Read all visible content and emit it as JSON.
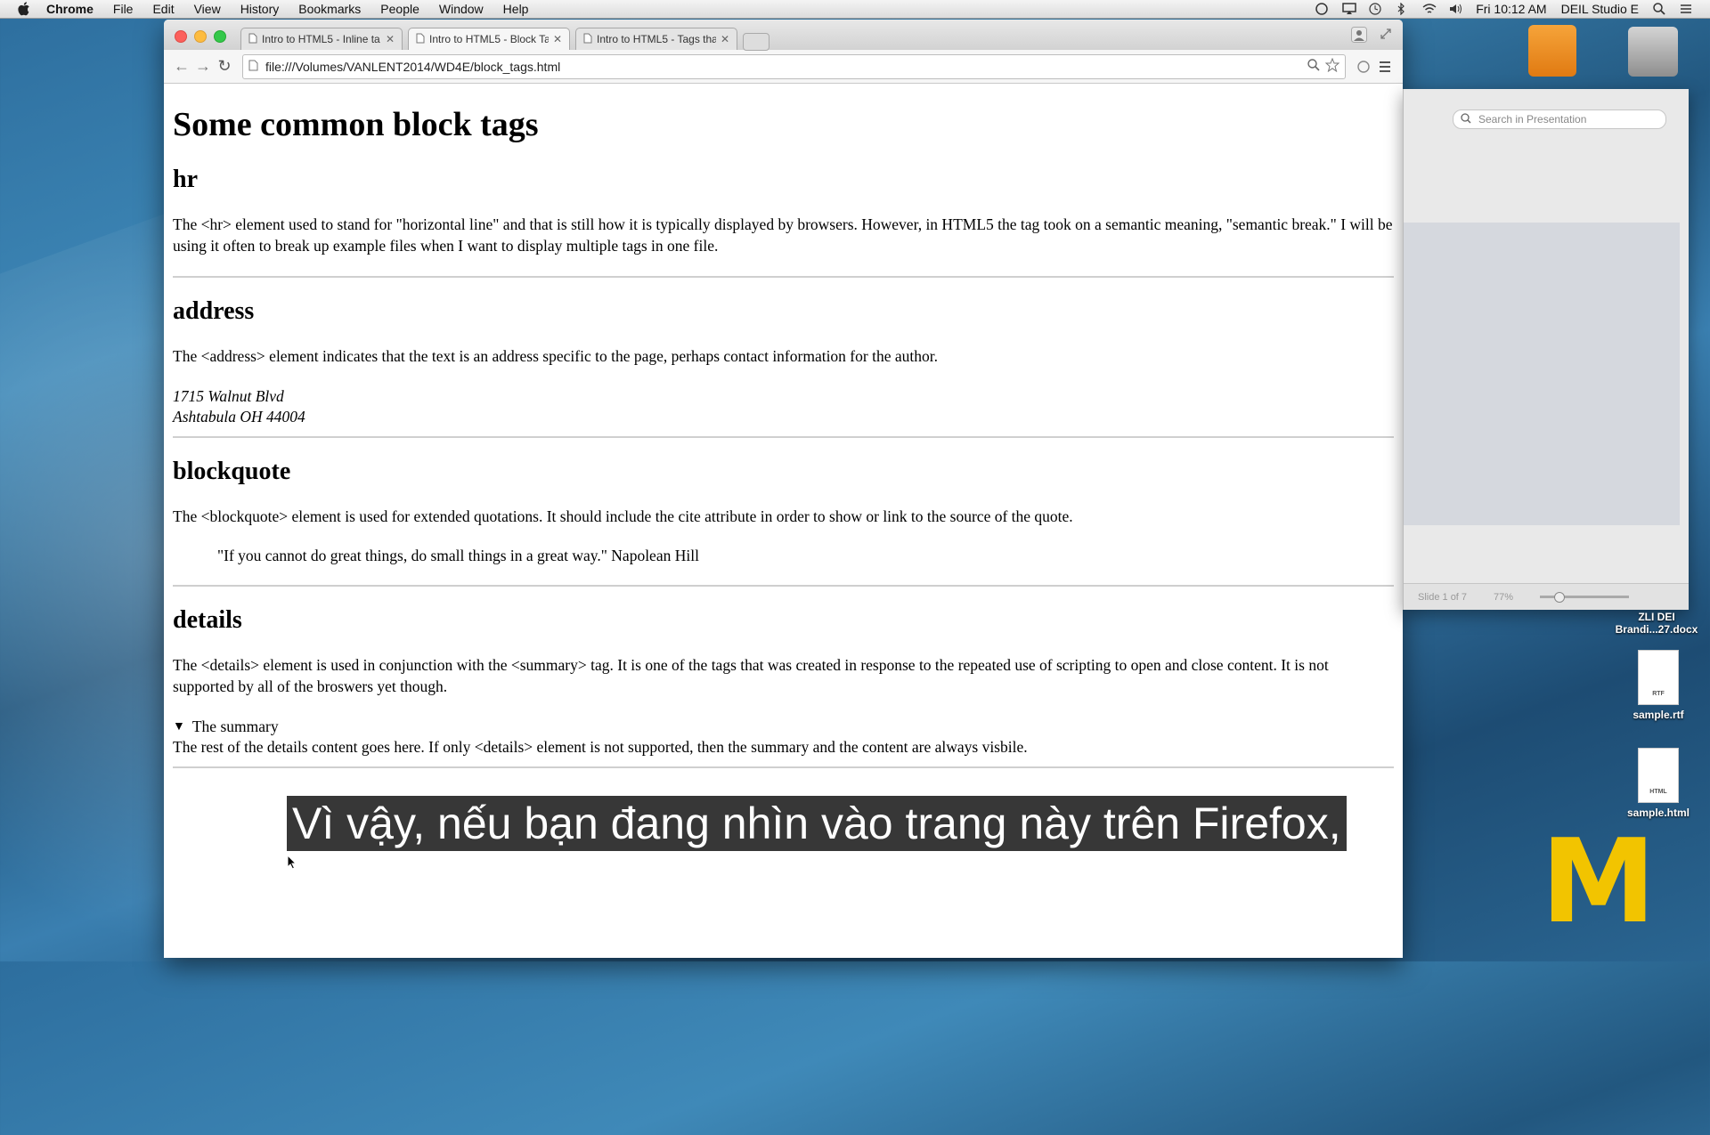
{
  "menubar": {
    "app": "Chrome",
    "items": [
      "File",
      "Edit",
      "View",
      "History",
      "Bookmarks",
      "People",
      "Window",
      "Help"
    ],
    "clock": "Fri 10:12 AM",
    "user": "DEIL Studio E"
  },
  "browser": {
    "tabs": [
      {
        "label": "Intro to HTML5 - Inline ta"
      },
      {
        "label": "Intro to HTML5 - Block Ta"
      },
      {
        "label": "Intro to HTML5 - Tags tha"
      }
    ],
    "url": "file:///Volumes/VANLENT2014/WD4E/block_tags.html"
  },
  "page": {
    "title": "Some common block tags",
    "sections": {
      "hr": {
        "heading": "hr",
        "text": "The <hr> element used to stand for \"horizontal line\" and that is still how it is typically displayed by browsers. However, in HTML5 the tag took on a semantic meaning, \"semantic break.\" I will be using it often to break up example files when I want to display multiple tags in one file."
      },
      "address": {
        "heading": "address",
        "text": "The <address> element indicates that the text is an address specific to the page, perhaps contact information for the author.",
        "line1": "1715 Walnut Blvd",
        "line2": "Ashtabula OH 44004"
      },
      "blockquote": {
        "heading": "blockquote",
        "text": "The <blockquote> element is used for extended quotations. It should include the cite attribute in order to show or link to the source of the quote.",
        "quote": "\"If you cannot do great things, do small things in a great way.\" Napolean Hill"
      },
      "details": {
        "heading": "details",
        "text": "The <details> element is used in conjunction with the <summary> tag. It is one of the tags that was created in response to the repeated use of scripting to open and close content. It is not supported by all of the broswers yet though.",
        "summary": "The summary",
        "content": "The rest of the details content goes here. If only <details> element is not supported, then the summary and the content are always visbile."
      }
    }
  },
  "presentation": {
    "search_placeholder": "Search in Presentation",
    "slide_status": "Slide 1 of 7",
    "zoom": "77%"
  },
  "desktop": {
    "icons": [
      {
        "label_1": "ZLI DEI",
        "label_2": "Brandi...27.docx"
      },
      {
        "label": "sample.rtf",
        "tag": "RTF"
      },
      {
        "label": "sample.html",
        "tag": "HTML"
      }
    ]
  },
  "subtitle": "Vì vậy, nếu bạn đang nhìn vào trang này trên Firefox,"
}
